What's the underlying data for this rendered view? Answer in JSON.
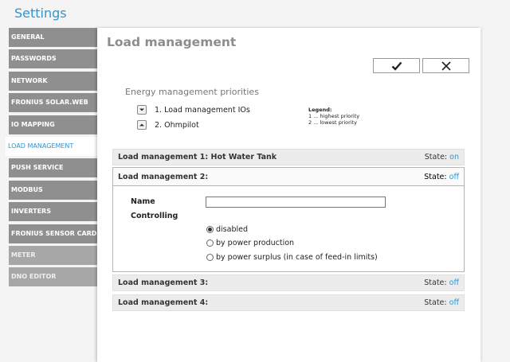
{
  "app": {
    "title": "Settings"
  },
  "sidebar": {
    "items": [
      {
        "label": "GENERAL",
        "state": "normal"
      },
      {
        "label": "PASSWORDS",
        "state": "normal"
      },
      {
        "label": "NETWORK",
        "state": "normal"
      },
      {
        "label": "FRONIUS SOLAR.WEB",
        "state": "normal"
      },
      {
        "label": "IO MAPPING",
        "state": "normal"
      },
      {
        "label": "LOAD MANAGEMENT",
        "state": "active"
      },
      {
        "label": "PUSH SERVICE",
        "state": "normal"
      },
      {
        "label": "MODBUS",
        "state": "normal"
      },
      {
        "label": "INVERTERS",
        "state": "normal"
      },
      {
        "label": "FRONIUS SENSOR CARDS",
        "state": "normal"
      },
      {
        "label": "METER",
        "state": "dim"
      },
      {
        "label": "DNO EDITOR",
        "state": "dim"
      }
    ]
  },
  "main": {
    "title": "Load management",
    "confirm_icon": "checkmark-icon",
    "cancel_icon": "close-icon",
    "priorities": {
      "heading": "Energy management priorities",
      "items": [
        {
          "number": "1.",
          "label": "Load management IOs",
          "arrow": "down"
        },
        {
          "number": "2.",
          "label": "Ohmpilot",
          "arrow": "up"
        }
      ],
      "legend": {
        "title": "Legend:",
        "line1": "1 ... highest priority",
        "line2": "2 ... lowest priority"
      }
    },
    "state_label": "State:",
    "lm1": {
      "label": "Load management 1: Hot Water Tank",
      "state": "on"
    },
    "lm2": {
      "label": "Load management 2:",
      "state": "off",
      "name_label": "Name",
      "name_value": "",
      "controlling_label": "Controlling",
      "options": [
        "disabled",
        "by power production",
        "by power surplus (in case of feed-in limits)"
      ],
      "selected": "disabled"
    },
    "lm3": {
      "label": "Load management 3:",
      "state": "off"
    },
    "lm4": {
      "label": "Load management 4:",
      "state": "off"
    }
  },
  "colors": {
    "accent": "#2e95d3",
    "nav_bg": "#8f8f8f",
    "nav_dim": "#a7a7a7"
  }
}
